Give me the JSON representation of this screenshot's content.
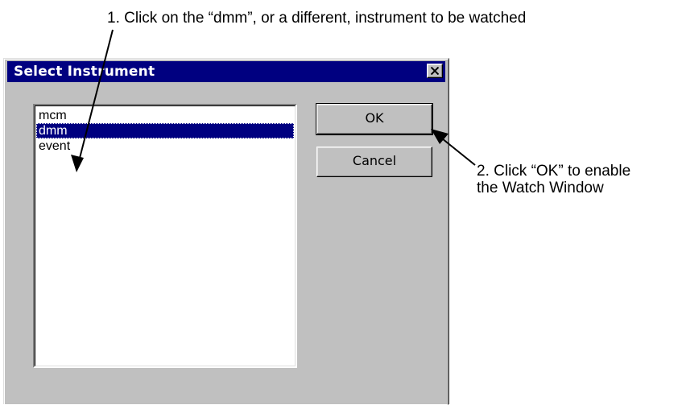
{
  "annotations": {
    "step1": "1. Click on the “dmm”, or a different, instrument to be watched",
    "step2_line1": "2. Click “OK” to enable",
    "step2_line2": "the Watch Window"
  },
  "dialog": {
    "title": "Select Instrument",
    "close_icon": "close-x-icon",
    "list": {
      "items": [
        "mcm",
        "dmm",
        "event"
      ],
      "selected": "dmm"
    },
    "buttons": {
      "ok": "OK",
      "cancel": "Cancel"
    }
  },
  "colors": {
    "titlebar": "#000080",
    "face": "#c0c0c0",
    "selection": "#000080"
  }
}
